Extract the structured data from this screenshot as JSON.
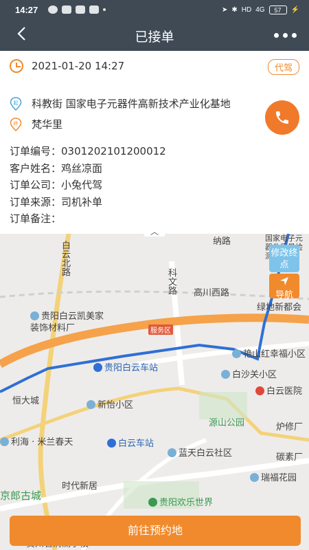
{
  "status_bar": {
    "time": "14:27",
    "signal_text": "4G",
    "hd_text": "HD",
    "battery": "57"
  },
  "header": {
    "title": "已接单",
    "back_icon": "chevron-left-icon",
    "more_icon": "more-dots-icon"
  },
  "order": {
    "datetime": "2021-01-20 14:27",
    "tag": "代驾",
    "pickup_address": "科教街 国家电子元器件高新技术产业化基地",
    "dropoff_address": "梵华里",
    "pickup_pin_label": "起",
    "dropoff_pin_label": "终",
    "fields": [
      {
        "label": "订单编号：",
        "value": "0301202101200012"
      },
      {
        "label": "客户姓名：",
        "value": "鸡丝凉面"
      },
      {
        "label": "订单公司：",
        "value": "小兔代驾"
      },
      {
        "label": "订单来源：",
        "value": "司机补单"
      },
      {
        "label": "订单备注：",
        "value": ""
      }
    ]
  },
  "map": {
    "modify_button": "修改终点",
    "nav_button": "导航",
    "labels": {
      "baiyun_north": "白云北路",
      "keyun": "科文路",
      "gaochuan": "高川西路",
      "lvdi": "绿地新都会",
      "kaimei": "贵阳白云凯美家装饰材料厂",
      "service": "服务区",
      "baiyun_station_main": "贵阳白云车站",
      "yanshan": "艳山红幸福小区",
      "baishaguan": "白沙关小区",
      "hengda": "恒大城",
      "xinyi": "新怡小区",
      "baiyun_hospital": "白云医院",
      "yuanshan": "源山公园",
      "luxiu": "炉修厂",
      "lihai": "利海 · 米兰春天",
      "baiyun_station": "白云车站",
      "lantian": "蓝天白云社区",
      "tansu": "碳素厂",
      "shidai": "时代新居",
      "ruifu": "瑞福花园",
      "happy_world": "贵阳欢乐世界",
      "jinglang": "京郎古城",
      "guozhou": "贵州省清测学校",
      "nachu": "纳路",
      "guozhi": "国家电子元器件质量检测基地"
    }
  },
  "bottom_button": "前往预约地",
  "colors": {
    "primary": "#f08a2c",
    "header_bg": "#3f4a55",
    "route": "#2f6fd6"
  }
}
